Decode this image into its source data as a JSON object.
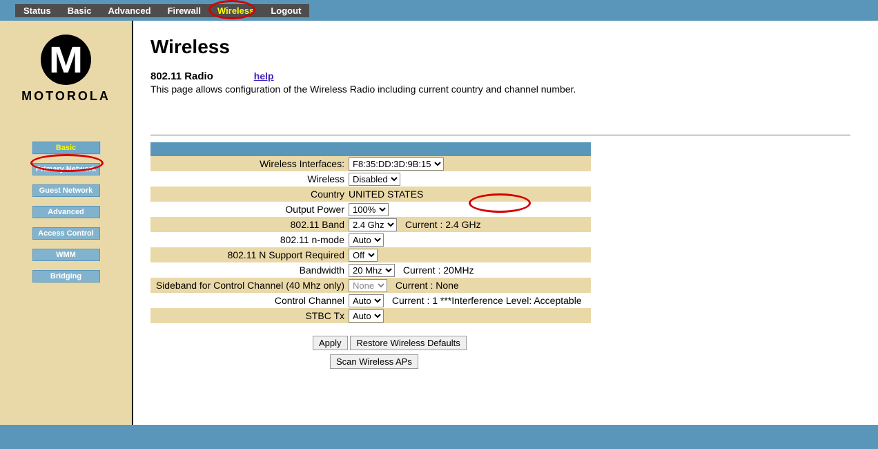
{
  "topnav": {
    "items": [
      {
        "label": "Status"
      },
      {
        "label": "Basic"
      },
      {
        "label": "Advanced"
      },
      {
        "label": "Firewall"
      },
      {
        "label": "Wireless"
      },
      {
        "label": "Logout"
      }
    ],
    "active_index": 4
  },
  "logo": {
    "brand": "MOTOROLA"
  },
  "sidebar": {
    "items": [
      {
        "label": "Basic"
      },
      {
        "label": "Primary Network"
      },
      {
        "label": "Guest Network"
      },
      {
        "label": "Advanced"
      },
      {
        "label": "Access Control"
      },
      {
        "label": "WMM"
      },
      {
        "label": "Bridging"
      }
    ],
    "active_index": 0
  },
  "page": {
    "title": "Wireless",
    "subtitle": "802.11 Radio",
    "help_label": "help",
    "description": "This page allows configuration of the Wireless Radio including current country and channel number."
  },
  "rows": {
    "wireless_interfaces": {
      "label": "Wireless Interfaces:",
      "value": "F8:35:DD:3D:9B:15"
    },
    "wireless": {
      "label": "Wireless",
      "value": "Disabled"
    },
    "country": {
      "label": "Country",
      "value": "UNITED STATES"
    },
    "output_power": {
      "label": "Output Power",
      "value": "100%"
    },
    "band": {
      "label": "802.11 Band",
      "value": "2.4 Ghz",
      "after": "Current :  2.4 GHz"
    },
    "nmode": {
      "label": "802.11 n-mode",
      "value": "Auto"
    },
    "nsupport": {
      "label": "802.11 N Support Required",
      "value": "Off"
    },
    "bandwidth": {
      "label": "Bandwidth",
      "value": "20 Mhz",
      "after": "Current :  20MHz"
    },
    "sideband": {
      "label": "Sideband for Control Channel (40 Mhz only)",
      "value": "None",
      "after": "Current : None"
    },
    "control": {
      "label": "Control Channel",
      "value": "Auto",
      "after": "Current :  1 ***Interference Level: Acceptable"
    },
    "stbc": {
      "label": "STBC Tx",
      "value": "Auto"
    }
  },
  "buttons": {
    "apply": "Apply",
    "restore": "Restore Wireless Defaults",
    "scan": "Scan Wireless APs"
  }
}
